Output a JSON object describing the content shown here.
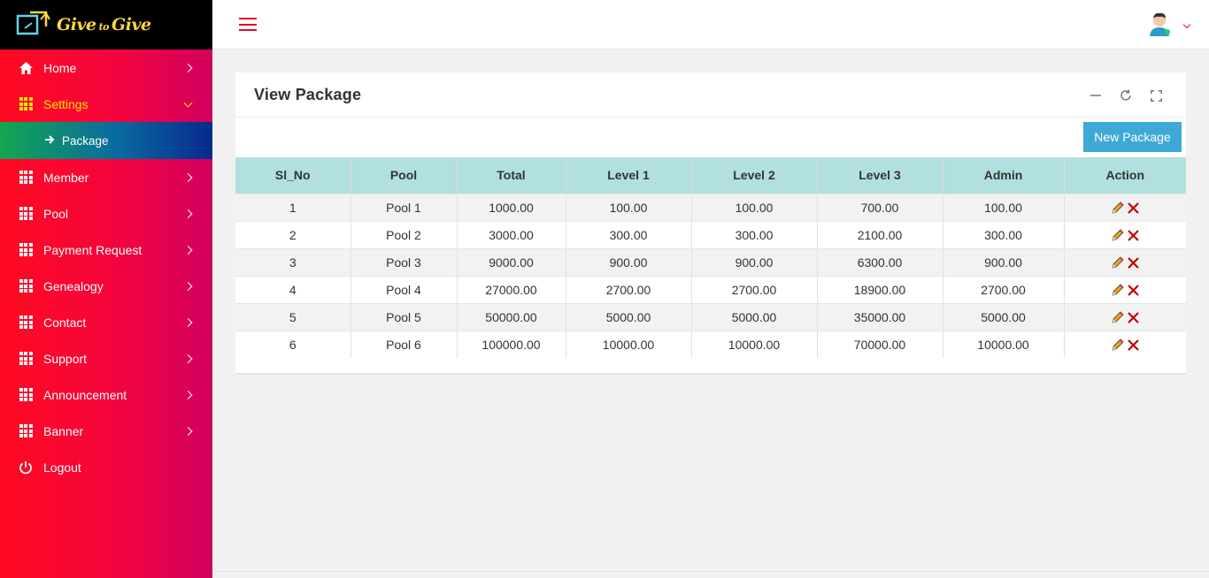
{
  "brand": {
    "part1": "Give",
    "part2": "to",
    "part3": "Give"
  },
  "sidebar": {
    "items": [
      {
        "label": "Home",
        "icon": "home-icon"
      },
      {
        "label": "Settings",
        "icon": "grid-icon",
        "active": true
      },
      {
        "label": "Member",
        "icon": "grid-icon"
      },
      {
        "label": "Pool",
        "icon": "grid-icon"
      },
      {
        "label": "Payment Request",
        "icon": "grid-icon"
      },
      {
        "label": "Genealogy",
        "icon": "grid-icon"
      },
      {
        "label": "Contact",
        "icon": "grid-icon"
      },
      {
        "label": "Support",
        "icon": "grid-icon"
      },
      {
        "label": "Announcement",
        "icon": "grid-icon"
      },
      {
        "label": "Banner",
        "icon": "grid-icon"
      },
      {
        "label": "Logout",
        "icon": "power-icon"
      }
    ],
    "sub_items": [
      {
        "label": "Package",
        "icon": "arrow-right-icon"
      }
    ]
  },
  "panel": {
    "title": "View Package",
    "new_button": "New Package"
  },
  "table": {
    "headers": [
      "Sl_No",
      "Pool",
      "Total",
      "Level 1",
      "Level 2",
      "Level 3",
      "Admin",
      "Action"
    ],
    "rows": [
      [
        "1",
        "Pool 1",
        "1000.00",
        "100.00",
        "100.00",
        "700.00",
        "100.00"
      ],
      [
        "2",
        "Pool 2",
        "3000.00",
        "300.00",
        "300.00",
        "2100.00",
        "300.00"
      ],
      [
        "3",
        "Pool 3",
        "9000.00",
        "900.00",
        "900.00",
        "6300.00",
        "900.00"
      ],
      [
        "4",
        "Pool 4",
        "27000.00",
        "2700.00",
        "2700.00",
        "18900.00",
        "2700.00"
      ],
      [
        "5",
        "Pool 5",
        "50000.00",
        "5000.00",
        "5000.00",
        "35000.00",
        "5000.00"
      ],
      [
        "6",
        "Pool 6",
        "100000.00",
        "10000.00",
        "10000.00",
        "70000.00",
        "10000.00"
      ]
    ]
  },
  "colors": {
    "sidebar_start": "#ff0a22",
    "sidebar_end": "#d2005f",
    "active_text": "#ffe500",
    "table_header": "#b2dfdf",
    "button": "#3ea9d6",
    "hamburger": "#e0101f"
  }
}
